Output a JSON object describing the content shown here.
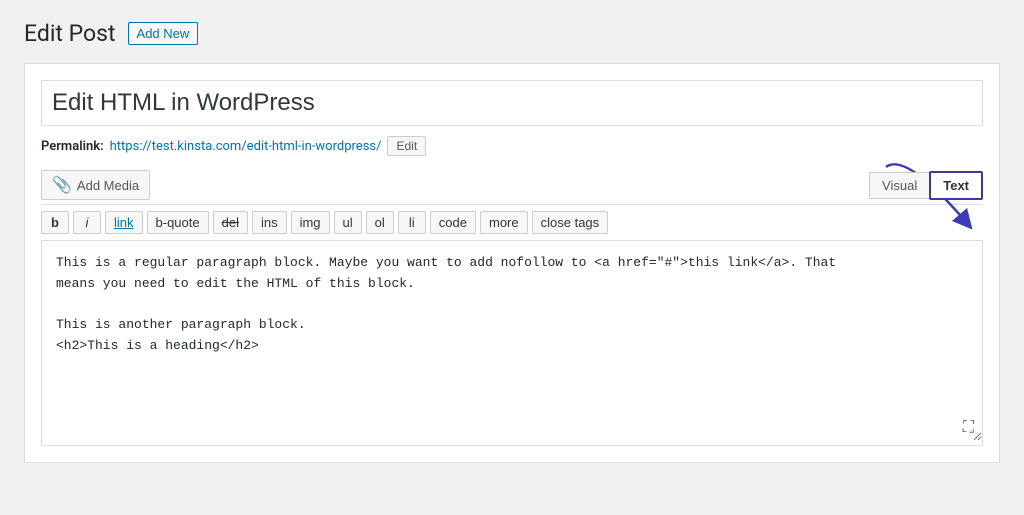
{
  "header": {
    "title": "Edit Post",
    "add_new_label": "Add New"
  },
  "post": {
    "title": "Edit HTML in WordPress",
    "permalink_label": "Permalink:",
    "permalink_url": "https://test.kinsta.com/edit-html-in-wordpress/",
    "edit_label": "Edit"
  },
  "toolbar": {
    "add_media_label": "Add Media",
    "tab_visual": "Visual",
    "tab_text": "Text"
  },
  "format_bar": {
    "buttons": [
      {
        "id": "bold",
        "label": "b",
        "style": "bold"
      },
      {
        "id": "italic",
        "label": "i",
        "style": "italic"
      },
      {
        "id": "link",
        "label": "link",
        "style": "link"
      },
      {
        "id": "b-quote",
        "label": "b-quote",
        "style": "normal"
      },
      {
        "id": "del",
        "label": "del",
        "style": "strikethrough"
      },
      {
        "id": "ins",
        "label": "ins",
        "style": "normal"
      },
      {
        "id": "img",
        "label": "img",
        "style": "normal"
      },
      {
        "id": "ul",
        "label": "ul",
        "style": "normal"
      },
      {
        "id": "ol",
        "label": "ol",
        "style": "normal"
      },
      {
        "id": "li",
        "label": "li",
        "style": "normal"
      },
      {
        "id": "code",
        "label": "code",
        "style": "normal"
      },
      {
        "id": "more",
        "label": "more",
        "style": "normal"
      },
      {
        "id": "close-tags",
        "label": "close tags",
        "style": "normal"
      }
    ]
  },
  "editor": {
    "content": "This is a regular paragraph block. Maybe you want to add nofollow to <a href=\"#\">this link</a>. That\nmeans you need to edit the HTML of this block.\n\nThis is another paragraph block.\n<h2>This is a heading</h2>"
  }
}
